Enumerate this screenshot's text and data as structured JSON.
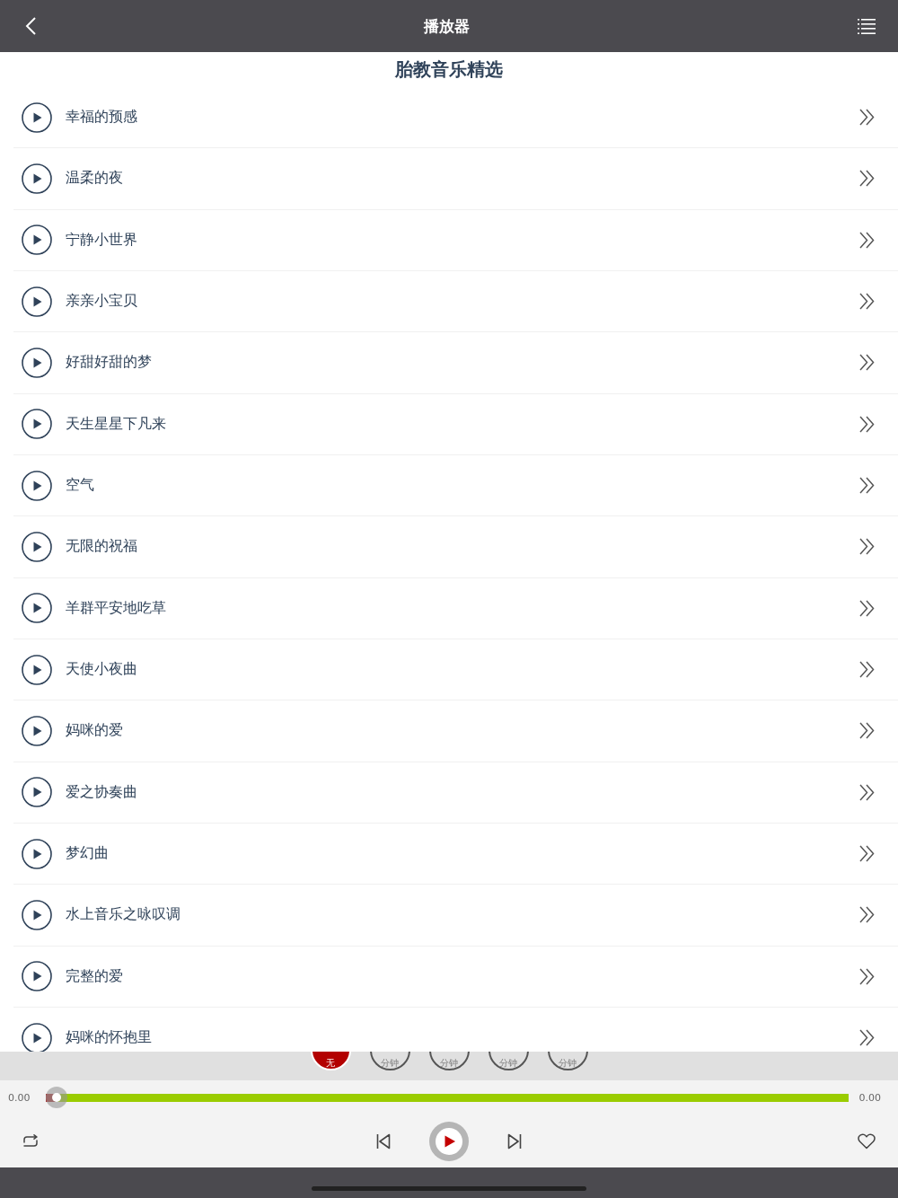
{
  "header": {
    "title": "播放器"
  },
  "playlist": {
    "title": "胎教音乐精选",
    "tracks": [
      {
        "title": "幸福的预感"
      },
      {
        "title": "温柔的夜"
      },
      {
        "title": "宁静小世界"
      },
      {
        "title": "亲亲小宝贝"
      },
      {
        "title": "好甜好甜的梦"
      },
      {
        "title": "天生星星下凡来"
      },
      {
        "title": "空气"
      },
      {
        "title": "无限的祝福"
      },
      {
        "title": "羊群平安地吃草"
      },
      {
        "title": "天使小夜曲"
      },
      {
        "title": "妈咪的爱"
      },
      {
        "title": "爱之协奏曲"
      },
      {
        "title": "梦幻曲"
      },
      {
        "title": "水上音乐之咏叹调"
      },
      {
        "title": "完整的爱"
      },
      {
        "title": "妈咪的怀抱里"
      }
    ]
  },
  "timer": {
    "options": [
      {
        "caption": "无",
        "selected": true
      },
      {
        "caption": "分钟",
        "selected": false
      },
      {
        "caption": "分钟",
        "selected": false
      },
      {
        "caption": "分钟",
        "selected": false
      },
      {
        "caption": "分钟",
        "selected": false
      }
    ]
  },
  "player": {
    "elapsed": "0.00",
    "duration": "0.00",
    "level": 0.013
  }
}
